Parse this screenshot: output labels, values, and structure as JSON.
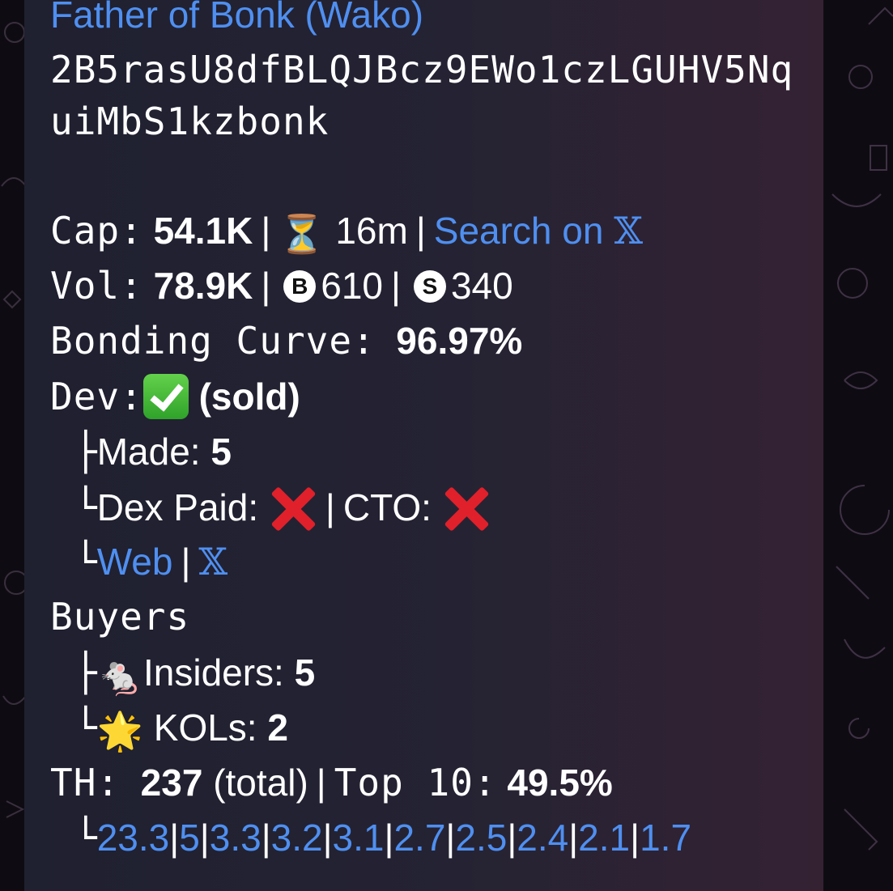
{
  "token": {
    "name": "Father of Bonk (Wako)",
    "address_line1": "2B5rasU8dfBLQJBcz9EWo1czLGUHV5Nq",
    "address_line2": "uiMbS1kzbonk"
  },
  "cap": {
    "label": "Cap:",
    "value": "54.1K",
    "sep": "|",
    "hourglass": "⏳",
    "age": "16m",
    "search_label": "Search on",
    "x_logo": "𝕏"
  },
  "vol": {
    "label": "Vol:",
    "value": "78.9K",
    "buy_badge": "B",
    "buys": "610",
    "sell_badge": "S",
    "sells": "340"
  },
  "bonding": {
    "label": "Bonding Curve:",
    "value": "96.97%"
  },
  "dev": {
    "label": "Dev:",
    "status_text": "(sold)",
    "made_branch": "├",
    "made_label": "Made:",
    "made_value": "5",
    "dex_branch": "└",
    "dex_label": "Dex Paid:",
    "cto_label": "CTO:",
    "links_branch": "└",
    "web_label": "Web",
    "x_logo": "𝕏"
  },
  "buyers": {
    "label": "Buyers",
    "insiders_branch": "├",
    "insiders_emoji": "🐁",
    "insiders_label": "Insiders:",
    "insiders_value": "5",
    "kols_branch": "└",
    "kols_emoji": "🌟",
    "kols_label": "KOLs:",
    "kols_value": "2"
  },
  "holders": {
    "label": "TH:",
    "total": "237",
    "total_suffix": "(total)",
    "top_label": "Top 10:",
    "top_value": "49.5%",
    "branch": "└",
    "top_list": [
      "23.3",
      "5",
      "3.3",
      "3.2",
      "3.1",
      "2.7",
      "2.5",
      "2.4",
      "2.1",
      "1.7"
    ]
  }
}
